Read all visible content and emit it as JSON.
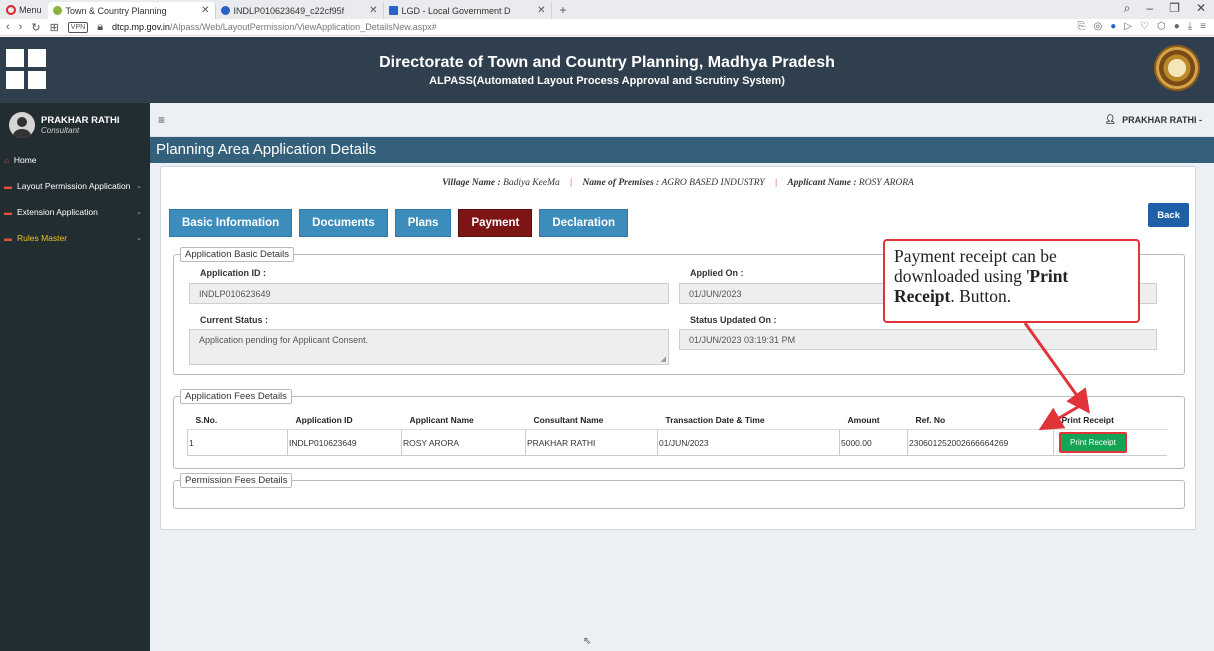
{
  "browser": {
    "menu_label": "Menu",
    "tabs": [
      {
        "title": "Town & Country Planning",
        "close": "✕"
      },
      {
        "title": "INDLP010623649_c22cf95f",
        "close": "✕"
      },
      {
        "title": "LGD - Local Government D",
        "close": "✕"
      }
    ],
    "new_tab": "+",
    "url_domain": "dtcp.mp.gov.in",
    "url_path": "/Alpass/Web/LayoutPermission/ViewApplication_DetailsNew.aspx#",
    "vpn": "VPN"
  },
  "banner": {
    "title": "Directorate of Town and Country Planning, Madhya Pradesh",
    "subtitle": "ALPASS(Automated Layout Process Approval and Scrutiny System)"
  },
  "sidebar": {
    "user_name": "PRAKHAR RATHI",
    "user_role": "Consultant",
    "items": [
      {
        "label": "Home"
      },
      {
        "label": "Layout Permission Application"
      },
      {
        "label": "Extension Application"
      },
      {
        "label": "Rules Master"
      }
    ]
  },
  "topbar": {
    "user": "PRAKHAR RATHI -"
  },
  "page": {
    "title": "Planning Area Application Details",
    "info": {
      "village_key": "Village Name :",
      "village_val": "Badiya KeeMa",
      "premises_key": "Name of Premises :",
      "premises_val": "AGRO BASED INDUSTRY",
      "applicant_key": "Applicant Name :",
      "applicant_val": "ROSY ARORA",
      "sep": "|"
    },
    "tabs": [
      "Basic Information",
      "Documents",
      "Plans",
      "Payment",
      "Declaration"
    ],
    "active_tab": "Payment",
    "back": "Back"
  },
  "basic_details": {
    "legend": "Application Basic Details",
    "application_id_label": "Application ID :",
    "application_id": "INDLP010623649",
    "applied_on_label": "Applied On :",
    "applied_on": "01/JUN/2023",
    "current_status_label": "Current Status :",
    "current_status": "Application pending for Applicant Consent.",
    "status_updated_label": "Status Updated On :",
    "status_updated": "01/JUN/2023 03:19:31 PM"
  },
  "fees": {
    "legend": "Application Fees Details",
    "headers": [
      "S.No.",
      "Application ID",
      "Applicant Name",
      "Consultant Name",
      "Transaction Date & Time",
      "Amount",
      "Ref. No",
      "Print Receipt"
    ],
    "row": {
      "sno": "1",
      "application_id": "INDLP010623649",
      "applicant": "ROSY ARORA",
      "consultant": "PRAKHAR RATHI",
      "date": "01/JUN/2023",
      "amount": "5000.00",
      "ref": "230601252002666664269",
      "button": "Print Receipt"
    }
  },
  "permission_fees": {
    "legend": "Permission Fees Details"
  },
  "callout": {
    "line1": "Payment receipt can be downloaded using '",
    "bold": "Print Receipt",
    "line2": ". Button."
  },
  "colors": {
    "accent": "#3c8dbc",
    "active_tab": "#7d1515",
    "header": "#35607b",
    "print_btn": "#13a455",
    "annotation": "#e0343a"
  }
}
